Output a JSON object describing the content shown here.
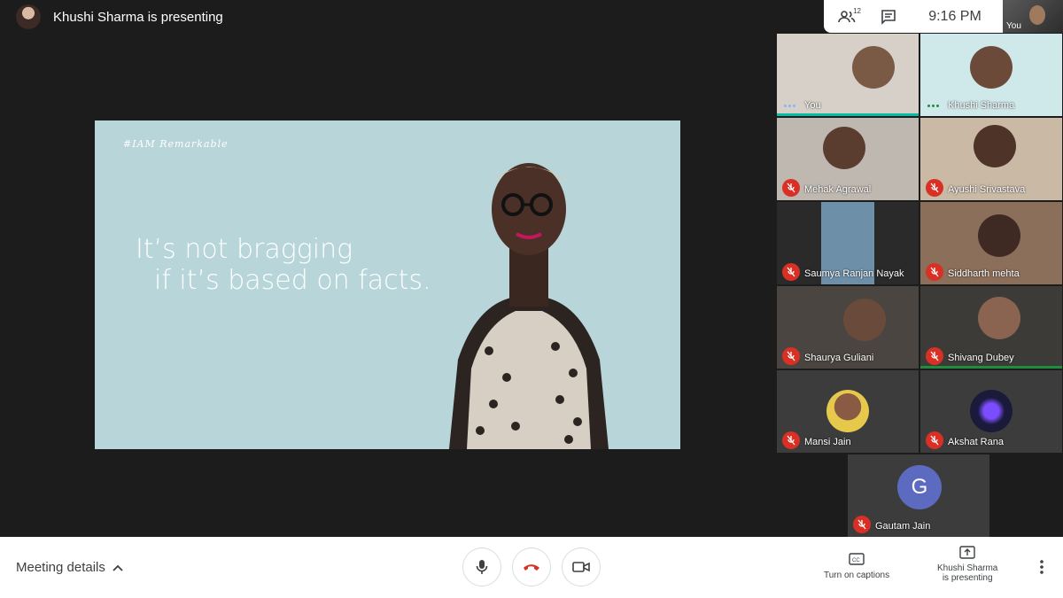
{
  "presenter": {
    "text": "Khushi Sharma is presenting"
  },
  "top_controls": {
    "people_count": "12",
    "time": "9:16 PM"
  },
  "self_view": {
    "label": "You"
  },
  "slide": {
    "brand": "#IAM Remarkable",
    "line1": "It’s not bragging",
    "line2": "if it’s based on facts."
  },
  "participants": [
    {
      "name": "You",
      "muted": false,
      "speaking": true
    },
    {
      "name": "Khushi Sharma",
      "muted": false,
      "speaking": false
    },
    {
      "name": "Mehak Agrawal",
      "muted": true
    },
    {
      "name": "Ayushi Srivastava",
      "muted": true
    },
    {
      "name": "Saumya Ranjan Nayak",
      "muted": true
    },
    {
      "name": "Siddharth mehta",
      "muted": true
    },
    {
      "name": "Shaurya Guliani",
      "muted": true
    },
    {
      "name": "Shivang Dubey",
      "muted": true
    },
    {
      "name": "Mansi Jain",
      "muted": true
    },
    {
      "name": "Akshat Rana",
      "muted": true
    },
    {
      "name": "Gautam Jain",
      "muted": true,
      "initial": "G"
    }
  ],
  "bottom_bar": {
    "meeting_details": "Meeting details",
    "captions_label": "Turn on captions",
    "presenting_line1": "Khushi Sharma",
    "presenting_line2": "is presenting"
  },
  "colors": {
    "mute_red": "#d93025",
    "slide_bg": "#b8d5da",
    "avatar_g": "#5c6bc0"
  }
}
